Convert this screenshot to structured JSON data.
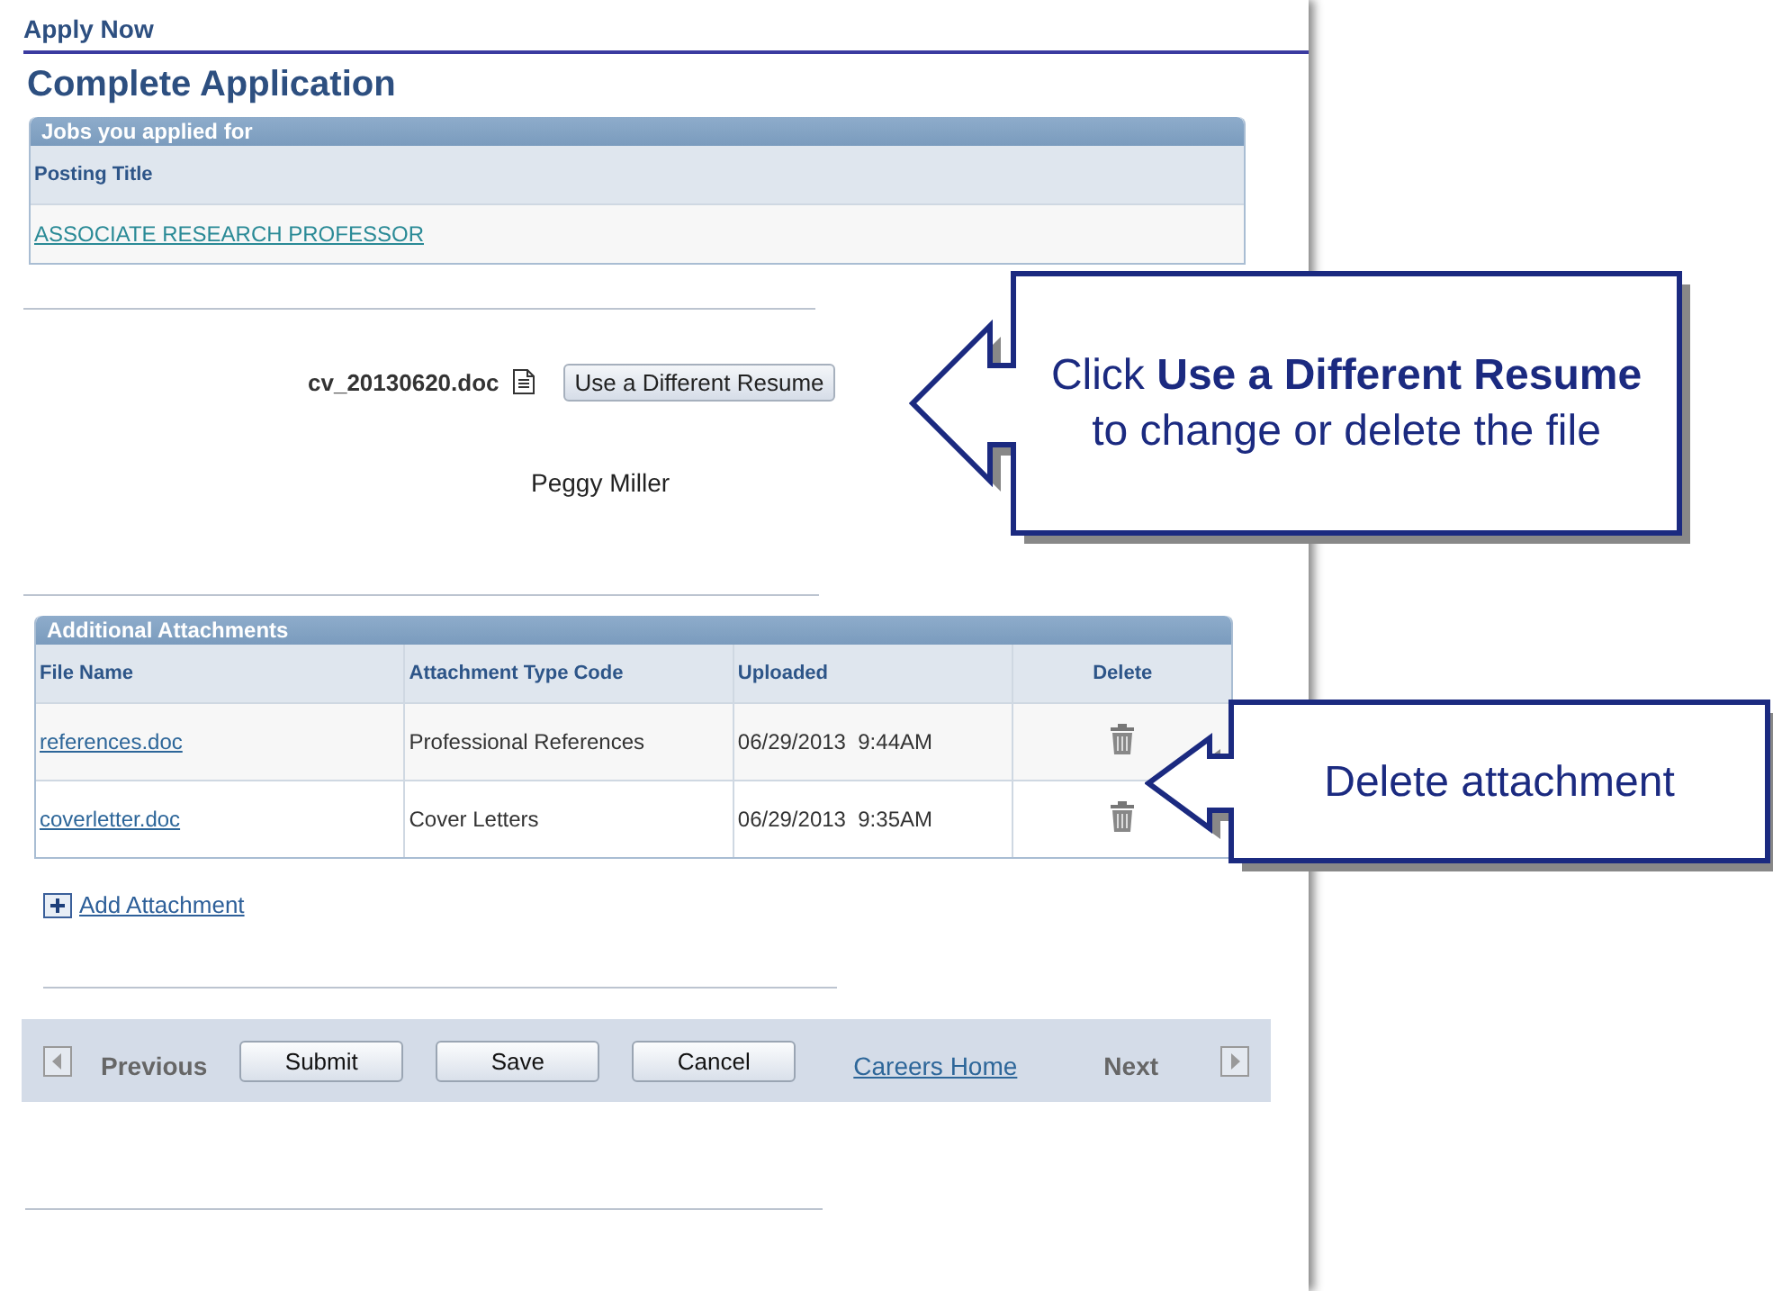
{
  "page": {
    "section_title": "Apply Now",
    "title": "Complete Application"
  },
  "jobs": {
    "header": "Jobs you applied for",
    "columns": [
      "Posting Title"
    ],
    "rows": [
      [
        "ASSOCIATE RESEARCH PROFESSOR"
      ]
    ]
  },
  "resume": {
    "file_name": "cv_20130620.doc",
    "button": "Use a Different Resume",
    "name": "Peggy Miller"
  },
  "attachments": {
    "header": "Additional Attachments",
    "columns": [
      "File Name",
      "Attachment Type Code",
      "Uploaded",
      "Delete"
    ],
    "rows": [
      {
        "file": "references.doc",
        "type": "Professional References",
        "uploaded": "06/29/2013  9:44AM"
      },
      {
        "file": "coverletter.doc",
        "type": "Cover Letters",
        "uploaded": "06/29/2013  9:35AM"
      }
    ]
  },
  "add_attachment": "Add Attachment",
  "toolbar": [
    {
      "kind": "prev",
      "label": "Previous",
      "disabled": true
    },
    {
      "kind": "button",
      "label": "Submit"
    },
    {
      "kind": "button",
      "label": "Save"
    },
    {
      "kind": "button",
      "label": "Cancel"
    },
    {
      "kind": "link",
      "label": "Careers Home"
    },
    {
      "kind": "next",
      "label": "Next",
      "disabled": true
    }
  ],
  "callouts": [
    {
      "text": "Click **Use a Different Resume** to change or delete the file"
    },
    {
      "text": "Delete attachment"
    }
  ]
}
